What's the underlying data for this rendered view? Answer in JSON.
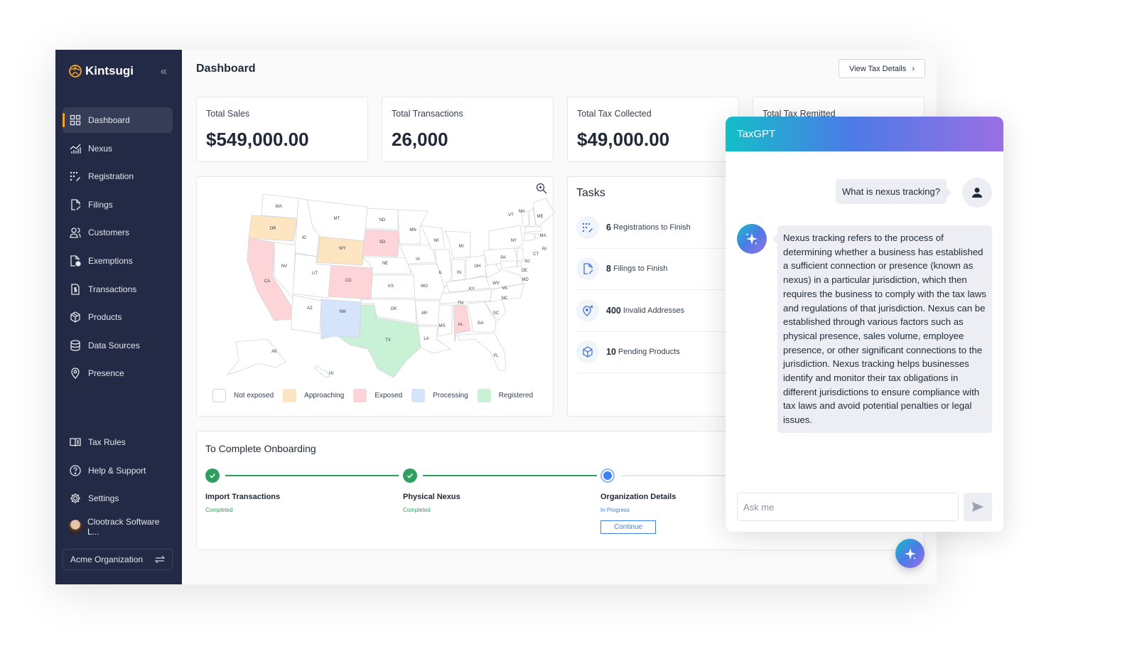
{
  "brand": {
    "name": "Kintsugi",
    "accent": "#f5a623"
  },
  "sidebar": {
    "items": [
      {
        "label": "Dashboard",
        "icon": "dashboard-icon",
        "active": true
      },
      {
        "label": "Nexus",
        "icon": "chart-icon"
      },
      {
        "label": "Registration",
        "icon": "registration-icon"
      },
      {
        "label": "Filings",
        "icon": "filings-icon"
      },
      {
        "label": "Customers",
        "icon": "customers-icon"
      },
      {
        "label": "Exemptions",
        "icon": "exemptions-icon"
      },
      {
        "label": "Transactions",
        "icon": "transactions-icon"
      },
      {
        "label": "Products",
        "icon": "products-icon"
      },
      {
        "label": "Data Sources",
        "icon": "database-icon"
      },
      {
        "label": "Presence",
        "icon": "location-pin-icon"
      }
    ],
    "bottom_items": [
      {
        "label": "Tax Rules",
        "icon": "book-icon"
      },
      {
        "label": "Help & Support",
        "icon": "help-icon"
      },
      {
        "label": "Settings",
        "icon": "gear-icon"
      }
    ],
    "user_name": "Clootrack Software L...",
    "organization": "Acme Organization"
  },
  "header": {
    "title": "Dashboard",
    "view_tax_details": "View Tax Details"
  },
  "stats": [
    {
      "label": "Total Sales",
      "value": "$549,000.00"
    },
    {
      "label": "Total Transactions",
      "value": "26,000"
    },
    {
      "label": "Total Tax Collected",
      "value": "$49,000.00"
    },
    {
      "label": "Total Tax Remitted",
      "value": ""
    }
  ],
  "map": {
    "legend": [
      {
        "label": "Not exposed",
        "color": "#ffffff"
      },
      {
        "label": "Approaching",
        "color": "#fde5c2"
      },
      {
        "label": "Exposed",
        "color": "#fdd5d8"
      },
      {
        "label": "Processing",
        "color": "#d6e4fb"
      },
      {
        "label": "Registered",
        "color": "#c8f1d6"
      }
    ],
    "states": {
      "approaching": [
        "OR",
        "WY"
      ],
      "exposed": [
        "CA",
        "SD",
        "CO",
        "AL"
      ],
      "processing": [
        "NM"
      ],
      "registered": [
        "TX"
      ]
    }
  },
  "tasks": {
    "title": "Tasks",
    "items": [
      {
        "count": "6",
        "label": "Registrations to Finish"
      },
      {
        "count": "8",
        "label": "Filings to Finish"
      },
      {
        "count": "400",
        "label": "Invalid Addresses"
      },
      {
        "count": "10",
        "label": "Pending Products"
      }
    ]
  },
  "onboarding": {
    "title": "To Complete Onboarding",
    "steps": [
      {
        "name": "Import Transactions",
        "status": "Completed"
      },
      {
        "name": "Physical Nexus",
        "status": "Completed"
      },
      {
        "name": "Organization Details",
        "status": "In Progress",
        "action": "Continue"
      }
    ]
  },
  "chat": {
    "title": "TaxGPT",
    "user_message": "What is nexus tracking?",
    "bot_message": "Nexus tracking refers to the process of determining whether a business has established a sufficient connection or presence (known as nexus) in a particular jurisdiction, which then requires the business to comply with the tax laws and regulations of that jurisdiction. Nexus can be established through various factors such as physical presence, sales volume, employee presence, or other significant connections to the jurisdiction. Nexus tracking helps businesses identify and monitor their tax obligations in different jurisdictions to ensure compliance with tax laws and avoid potential penalties or legal issues.",
    "input_placeholder": "Ask me"
  }
}
